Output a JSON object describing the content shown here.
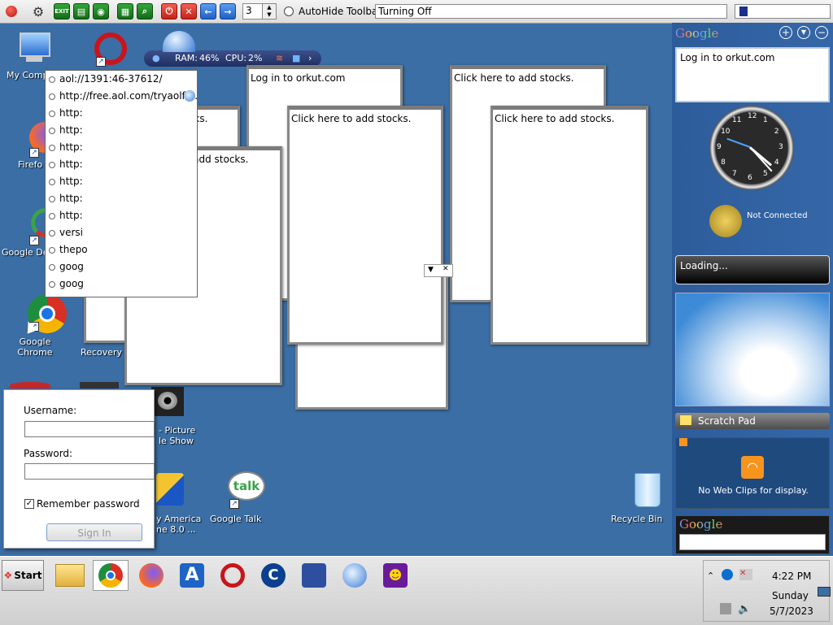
{
  "toolbar": {
    "counter_value": "3",
    "autohide_label": "AutoHide Toolbar",
    "status_text": "Turning Off",
    "exit_label": "EXIT"
  },
  "monitor": {
    "ram_label": "RAM:",
    "ram_value": "46%",
    "cpu_label": "CPU:",
    "cpu_value": "2%"
  },
  "desktop_icons": [
    {
      "label": "My Comp"
    },
    {
      "label": "Firefo"
    },
    {
      "label": "Google De"
    },
    {
      "label": "Google Chrome"
    },
    {
      "label": "Recovery"
    },
    {
      "label": "- Picture"
    },
    {
      "label": "le Show"
    },
    {
      "label": "y America"
    },
    {
      "label": "ne 8.0 ..."
    },
    {
      "label": "Google Talk"
    },
    {
      "label": "Recycle Bin"
    }
  ],
  "url_history": [
    "aol://1391:46-37612/",
    "http://free.aol.com/tryaolfr...",
    "http:",
    "http:",
    "http:",
    "http:",
    "http:",
    "http:",
    "http:",
    "versi",
    "thepo",
    "goog",
    "goog"
  ],
  "notes": {
    "stocks": "Click here to add stocks.",
    "orkut": "Log in to orkut.com"
  },
  "sidebar": {
    "google_logo": "Google",
    "orkut_text": "Log in to orkut.com",
    "weather_status": "Not Connected",
    "loading_text": "Loading...",
    "scratch_title": "Scratch Pad",
    "webclips_text": "No Web Clips for display.",
    "search_logo": "Google",
    "clock_numbers": [
      "12",
      "1",
      "2",
      "3",
      "4",
      "5",
      "6",
      "7",
      "8",
      "9",
      "10",
      "11"
    ]
  },
  "login": {
    "username_label": "Username:",
    "password_label": "Password:",
    "remember_label": "Remember password",
    "signin_label": "Sign In"
  },
  "taskbar": {
    "start_label": "Start",
    "time": "4:22 PM",
    "day": "Sunday",
    "date": "5/7/2023"
  },
  "colors": {
    "desktop": "#3a6ea5",
    "sidebar": "#2d5c9a"
  }
}
